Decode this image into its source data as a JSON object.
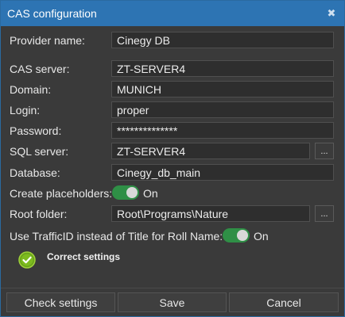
{
  "window": {
    "title": "CAS configuration",
    "close_glyph": "✖"
  },
  "form": {
    "provider_name": {
      "label": "Provider name:",
      "value": "Cinegy DB"
    },
    "cas_server": {
      "label": "CAS server:",
      "value": "ZT-SERVER4"
    },
    "domain": {
      "label": "Domain:",
      "value": "MUNICH"
    },
    "login": {
      "label": "Login:",
      "value": "proper"
    },
    "password": {
      "label": "Password:",
      "value": "**************"
    },
    "sql_server": {
      "label": "SQL server:",
      "value": "ZT-SERVER4",
      "browse_label": "..."
    },
    "database": {
      "label": "Database:",
      "value": "Cinegy_db_main"
    },
    "create_placeholders": {
      "label": "Create placeholders:",
      "state_text": "On",
      "enabled": true
    },
    "root_folder": {
      "label": "Root folder:",
      "value": "Root\\Programs\\Nature",
      "browse_label": "..."
    },
    "use_trafficid": {
      "label": "Use TrafficID instead of Title for Roll Name:",
      "state_text": "On",
      "enabled": true
    }
  },
  "status": {
    "icon": "check-circle-icon",
    "text": "Correct settings",
    "color": "#7dbb1f"
  },
  "buttons": {
    "check_settings": "Check settings",
    "save": "Save",
    "cancel": "Cancel"
  },
  "colors": {
    "titlebar": "#2d74b3",
    "toggle_on": "#2f8f46",
    "background": "#3a3a3a"
  }
}
